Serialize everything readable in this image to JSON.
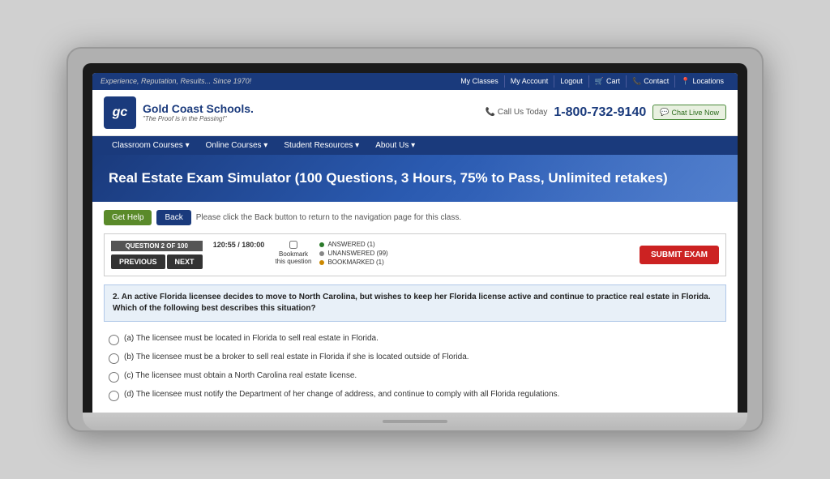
{
  "topnav": {
    "tagline": "Experience, Reputation, Results... Since 1970!",
    "items": [
      {
        "label": "My Classes",
        "icon": ""
      },
      {
        "label": "My Account",
        "icon": ""
      },
      {
        "label": "Logout",
        "icon": ""
      },
      {
        "label": "Cart",
        "icon": "🛒"
      },
      {
        "label": "Contact",
        "icon": "📞"
      },
      {
        "label": "Locations",
        "icon": "📍"
      }
    ]
  },
  "header": {
    "logo_initials": "gc",
    "logo_name": "Gold Coast Schools.",
    "logo_tagline": "\"The Proof is in the Passing!\"",
    "phone_label": "Call Us Today",
    "phone_number": "1-800-732-9140",
    "chat_label": "Chat Live Now"
  },
  "mainnav": {
    "items": [
      {
        "label": "Classroom Courses ▾"
      },
      {
        "label": "Online Courses ▾"
      },
      {
        "label": "Student Resources ▾"
      },
      {
        "label": "About Us ▾"
      }
    ]
  },
  "hero": {
    "title": "Real Estate Exam Simulator (100 Questions, 3 Hours, 75% to Pass, Unlimited retakes)"
  },
  "toolbar": {
    "help_label": "Get Help",
    "back_label": "Back",
    "note": "Please click the Back button to return to the navigation page for this class."
  },
  "question_controls": {
    "question_label": "QUESTION 2 OF 100",
    "prev_label": "PREVIOUS",
    "next_label": "NEXT",
    "timer": "120:55 / 180:00",
    "bookmark_label": "Bookmark\nthis question",
    "stats": [
      {
        "label": "ANSWERED (1)",
        "type": "answered"
      },
      {
        "label": "UNANSWERED (99)",
        "type": "unanswered"
      },
      {
        "label": "BOOKMARKED (1)",
        "type": "bookmarked"
      }
    ],
    "submit_label": "SUBMIT EXAM"
  },
  "question": {
    "number": "2.",
    "text": "An active Florida licensee decides to move to North Carolina, but wishes to keep her Florida license active and continue to practice real estate in Florida. Which of the following best describes this situation?",
    "answers": [
      {
        "id": "a",
        "text": "(a) The licensee must be located in Florida to sell real estate in Florida."
      },
      {
        "id": "b",
        "text": "(b) The licensee must be a broker to sell real estate in Florida if she is located outside of Florida."
      },
      {
        "id": "c",
        "text": "(c) The licensee must obtain a North Carolina real estate license."
      },
      {
        "id": "d",
        "text": "(d) The licensee must notify the Department of her change of address, and continue to comply with all Florida regulations."
      }
    ]
  }
}
